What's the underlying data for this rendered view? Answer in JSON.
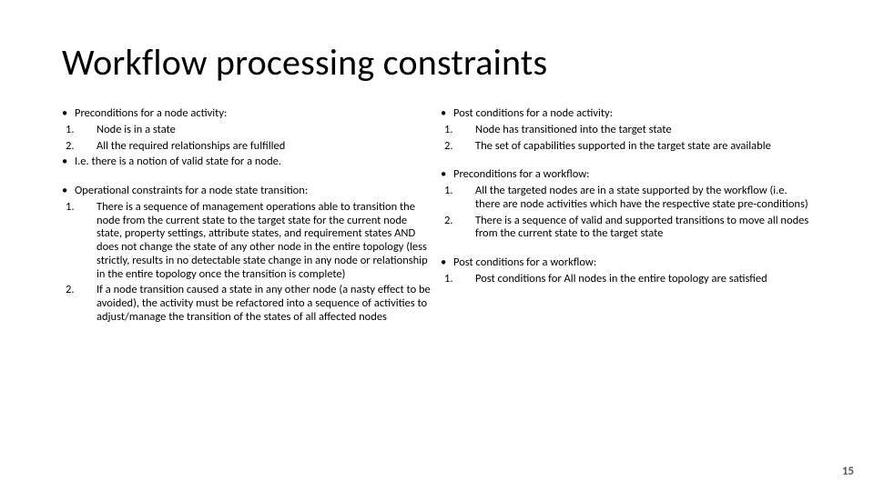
{
  "title": "Workflow processing constraints",
  "page_number": "15",
  "left": {
    "sec1": {
      "heading": "Preconditions for a node activity:",
      "items": [
        "Node is in a state",
        "All the required relationships are fulfilled"
      ],
      "note": "I.e. there is a notion of valid state for a node."
    },
    "sec2": {
      "heading": "Operational constraints for a node state transition:",
      "items": [
        "There is a sequence of management operations able to transition the node from the current state to the target state for the current node state, property settings, attribute states, and requirement states AND does not change the state of any other node in the entire topology (less strictly, results in no detectable state change in any node or relationship in the entire topology once the transition is complete)",
        "If a node transition caused a state in any other node (a nasty effect to be avoided), the activity must be refactored into a sequence of activities to adjust/manage the transition of the states of all affected nodes"
      ]
    }
  },
  "right": {
    "sec1": {
      "heading": "Post conditions for a node activity:",
      "items": [
        "Node has transitioned into the target state",
        "The set of capabilities supported in the target state are available"
      ]
    },
    "sec2": {
      "heading": "Preconditions for a workflow:",
      "items": [
        "All the targeted nodes are in a state supported by the workflow (i.e. there are node activities which have the respective state pre-conditions)",
        "There is a sequence of valid and supported transitions to move all nodes from the current state to the target state"
      ]
    },
    "sec3": {
      "heading": "Post conditions for a workflow:",
      "items": [
        "Post conditions for All nodes in the entire topology are satisfied"
      ]
    }
  }
}
